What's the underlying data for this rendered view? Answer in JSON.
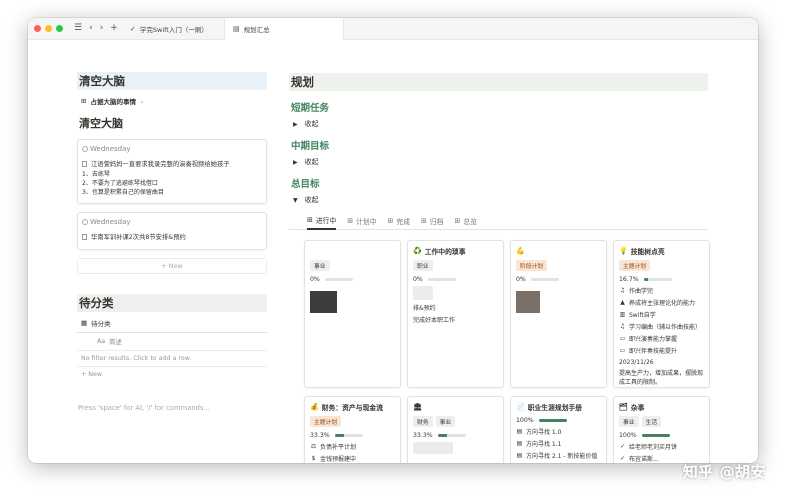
{
  "tabs": [
    {
      "label": "学完Swift入门（一刷）",
      "icon": "check-icon"
    },
    {
      "label": "规划汇总",
      "icon": "document-icon"
    }
  ],
  "left": {
    "title": "清空大脑",
    "db_view": "占据大脑的事情",
    "subtitle": "清空大脑",
    "cards": [
      {
        "day": "Wednesday",
        "title": "江语萱妈妈一直要求我录完整的演奏视频给她孩子",
        "lines": [
          "1、去练琴",
          "2、不要为了逃避练琴找借口",
          "3、也算是积累自己的保留曲目"
        ]
      },
      {
        "day": "Wednesday",
        "title": "华南军训补课2次共8节安排&预约",
        "lines": []
      }
    ],
    "new_label": "+ New",
    "pending_title": "待分类",
    "pending_tab": "待分类",
    "col_icon": "Aa",
    "col_name": "简述",
    "no_filter": "No filter results. Click to add a row.",
    "new_row": "+ New",
    "prompt": "Press 'space' for AI, '/' for commands..."
  },
  "right": {
    "title": "规划",
    "sections": [
      {
        "heading": "短期任务",
        "toggle": "收起",
        "open": false
      },
      {
        "heading": "中期目标",
        "toggle": "收起",
        "open": false
      },
      {
        "heading": "总目标",
        "toggle": "收起",
        "open": true
      }
    ],
    "view_tabs": [
      "进行中",
      "计划中",
      "完成",
      "归档",
      "总览"
    ],
    "cards": [
      {
        "emoji": "",
        "title": "",
        "tags": [
          "事业"
        ],
        "progress": "0%",
        "progress_value": 0,
        "lines": []
      },
      {
        "emoji": "♻️",
        "title": "工作中的琐事",
        "tags": [
          "职业"
        ],
        "progress": "0%",
        "progress_value": 0,
        "lines": [
          "排&预约",
          "完成好本职工作"
        ]
      },
      {
        "emoji": "💪",
        "title": "",
        "tags": [
          "阶段计划"
        ],
        "progress": "0%",
        "progress_value": 0,
        "lines": []
      },
      {
        "emoji": "💡",
        "title": "技能树点亮",
        "tags": [
          "主题计划"
        ],
        "progress": "16.7%",
        "progress_value": 16.7,
        "lines": [
          "作曲学完",
          "养成将主张理论化的能力",
          "Swift自学",
          "学习编曲（辅以作曲技能）",
          "即兴演奏能力掌握",
          "即兴伴奏技能提升"
        ],
        "date": "2023/11/26",
        "note": "提高生产力，增加成果，摆脱现成工具的限制。"
      },
      {
        "emoji": "💰",
        "title": "财务：资产与现金流",
        "tags": [
          "主题计划"
        ],
        "progress": "33.3%",
        "progress_value": 33.3,
        "lines": [
          "负债补平计划",
          "金钱预报建中"
        ]
      },
      {
        "emoji": "🏛",
        "title": "",
        "tags": [
          "财务",
          "事业"
        ],
        "progress": "33.3%",
        "progress_value": 33.3,
        "lines": []
      },
      {
        "emoji": "📄",
        "title": "职业生涯规划手册",
        "tags": [],
        "progress": "100%",
        "progress_value": 100,
        "lines": [
          "方向寻找 1.0",
          "方向寻找 1.1",
          "方向寻找 2.1 - 新技能价值"
        ]
      },
      {
        "emoji": "🗂",
        "title": "杂事",
        "tags": [
          "事业",
          "生活"
        ],
        "progress": "100%",
        "progress_value": 100,
        "lines": [
          "给老师老刘买月饼",
          "布宜诺斯..."
        ]
      }
    ]
  },
  "watermark": "知乎 @胡安"
}
